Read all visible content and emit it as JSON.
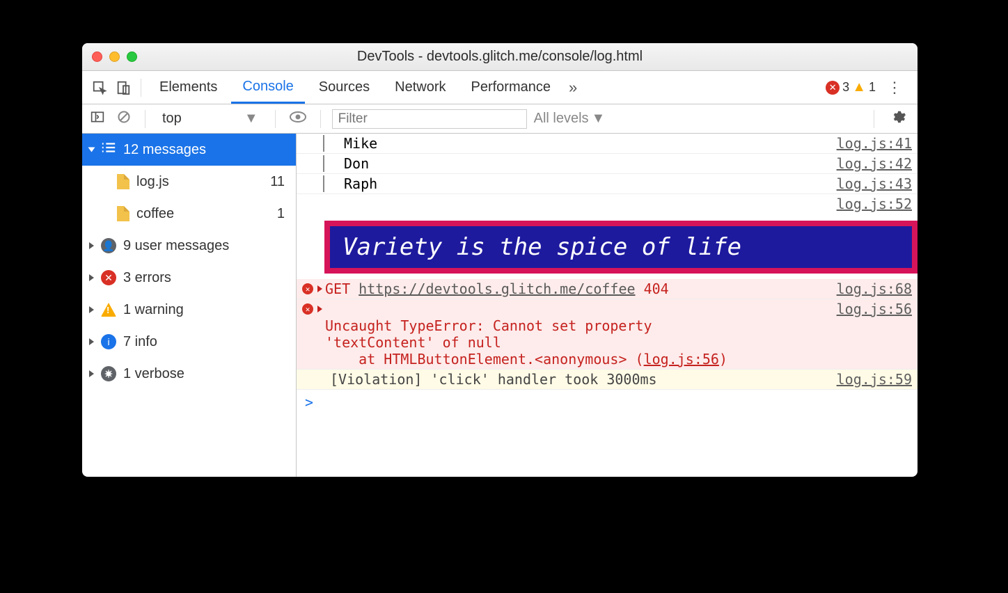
{
  "window": {
    "title": "DevTools - devtools.glitch.me/console/log.html"
  },
  "tabs": {
    "items": [
      "Elements",
      "Console",
      "Sources",
      "Network",
      "Performance"
    ],
    "active": "Console",
    "errorCount": "3",
    "warnCount": "1"
  },
  "toolbar": {
    "context": "top",
    "filterPlaceholder": "Filter",
    "levels": "All levels"
  },
  "sidebar": {
    "messages": {
      "label": "12 messages"
    },
    "files": [
      {
        "name": "log.js",
        "count": "11"
      },
      {
        "name": "coffee",
        "count": "1"
      }
    ],
    "cats": {
      "user": {
        "label": "9 user messages"
      },
      "errors": {
        "label": "3 errors"
      },
      "warning": {
        "label": "1 warning"
      },
      "info": {
        "label": "7 info"
      },
      "verbose": {
        "label": "1 verbose"
      }
    }
  },
  "console": {
    "groupRows": [
      {
        "text": "Mike",
        "src": "log.js:41"
      },
      {
        "text": "Don",
        "src": "log.js:42"
      },
      {
        "text": "Raph",
        "src": "log.js:43"
      }
    ],
    "styled": {
      "text": "Variety is the spice of life",
      "src": "log.js:52"
    },
    "error1": {
      "method": "GET",
      "url": "https://devtools.glitch.me/coffee",
      "status": "404",
      "src": "log.js:68"
    },
    "error2": {
      "line1": "Uncaught TypeError: Cannot set property",
      "line2": "'textContent' of null",
      "line3a": "    at HTMLButtonElement.<anonymous> (",
      "line3link": "log.js:56",
      "line3b": ")",
      "src": "log.js:56"
    },
    "violation": {
      "text": "[Violation] 'click' handler took 3000ms",
      "src": "log.js:59"
    },
    "prompt": ">"
  }
}
